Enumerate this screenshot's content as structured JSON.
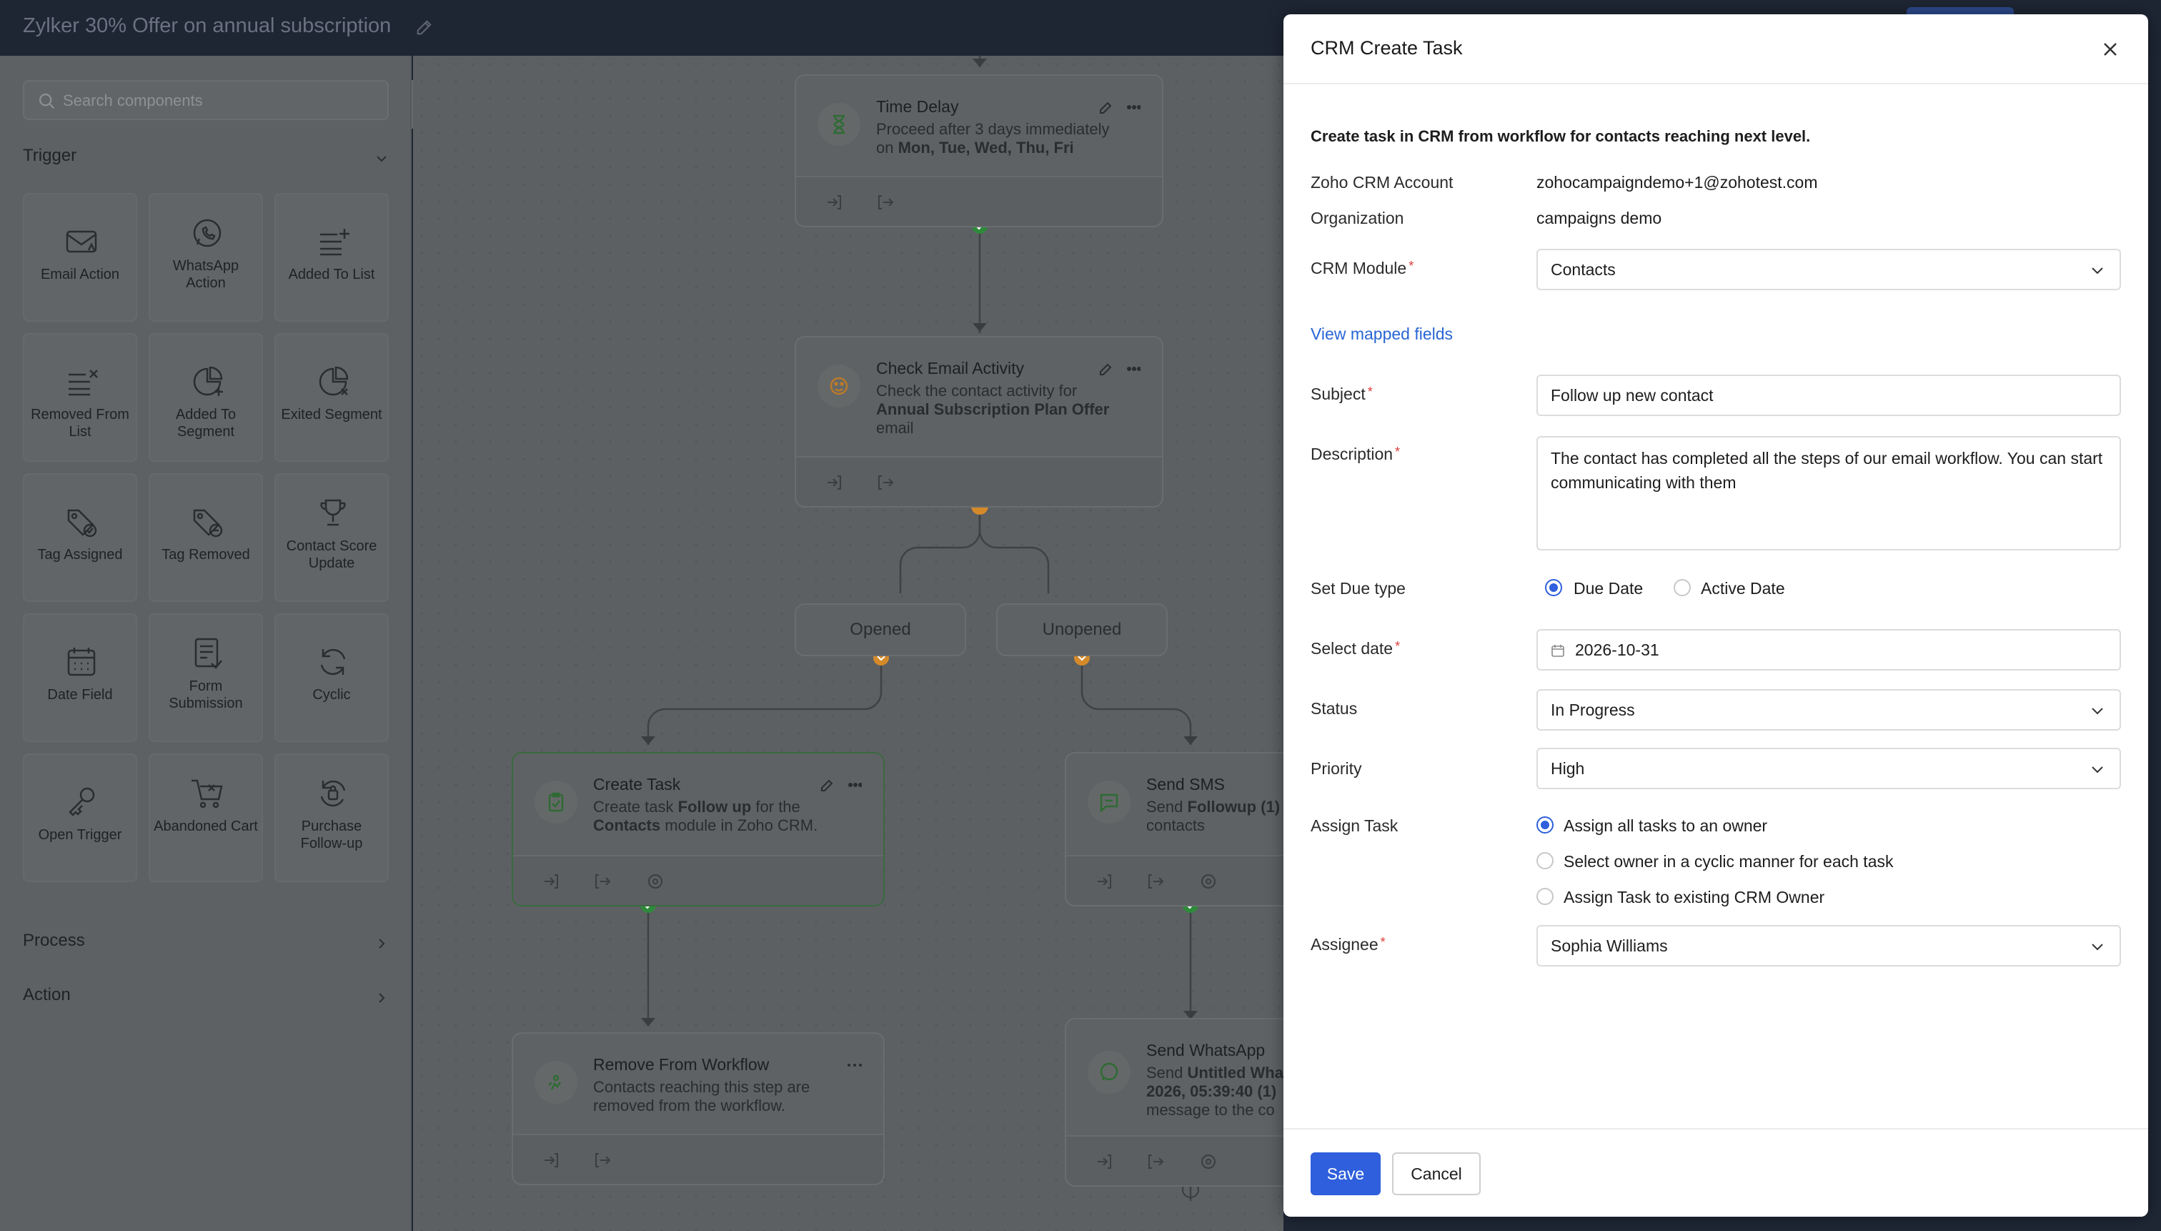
{
  "topbar": {
    "title": "Zylker 30% Offer on annual subscription"
  },
  "sidebar": {
    "search_placeholder": "Search components",
    "trigger_label": "Trigger",
    "process_label": "Process",
    "action_label": "Action",
    "tiles": [
      "Email Action",
      "WhatsApp Action",
      "Added To List",
      "Removed From List",
      "Added To Segment",
      "Exited Segment",
      "Tag Assigned",
      "Tag Removed",
      "Contact Score Update",
      "Date Field",
      "Form Submission",
      "Cyclic",
      "Open Trigger",
      "Abandoned Cart",
      "Purchase Follow-up"
    ]
  },
  "canvas": {
    "time_delay": {
      "title": "Time Delay",
      "desc_1": "Proceed after 3 days immediately",
      "desc_2": "on",
      "desc_bold": "Mon, Tue, Wed, Thu, Fri"
    },
    "check_email": {
      "title": "Check Email Activity",
      "desc_1": "Check the contact activity for",
      "desc_bold": "Annual Subscription Plan Offer",
      "desc_2": "email"
    },
    "branch_opened": "Opened",
    "branch_unopened": "Unopened",
    "create_task": {
      "title": "Create Task",
      "desc_1": "Create task",
      "desc_bold1": "Follow up",
      "desc_2": "for the",
      "desc_bold2": "Contacts",
      "desc_3": "module in Zoho CRM."
    },
    "send_sms": {
      "title": "Send SMS",
      "desc_1": "Send",
      "desc_bold": "Followup (1)",
      "desc_2": "contacts"
    },
    "remove_workflow": {
      "title": "Remove From Workflow",
      "desc_1": "Contacts reaching this step are",
      "desc_2": "removed from the workflow."
    },
    "send_whatsapp": {
      "title": "Send WhatsApp",
      "desc_1": "Send",
      "desc_bold": "Untitled Wha",
      "desc_2": "2026, 05:39:40 (1)",
      "desc_3": "message to the co"
    }
  },
  "modal": {
    "title": "CRM Create Task",
    "intro": "Create task in CRM from workflow for contacts reaching next level.",
    "account_label": "Zoho CRM Account",
    "account_value": "zohocampaigndemo+1@zohotest.com",
    "org_label": "Organization",
    "org_value": "campaigns demo",
    "module_label": "CRM Module",
    "module_value": "Contacts",
    "view_mapped": "View mapped fields",
    "subject_label": "Subject",
    "subject_value": "Follow up new contact",
    "description_label": "Description",
    "description_value": "The contact has completed all the steps of our email workflow. You can start communicating with them",
    "due_type_label": "Set Due type",
    "due_date_option": "Due Date",
    "active_date_option": "Active Date",
    "select_date_label": "Select date",
    "select_date_value": "2026-10-31",
    "status_label": "Status",
    "status_value": "In Progress",
    "priority_label": "Priority",
    "priority_value": "High",
    "assign_task_label": "Assign Task",
    "assign_opt1": "Assign all tasks to an owner",
    "assign_opt2": "Select owner in a cyclic manner for each task",
    "assign_opt3": "Assign Task to existing CRM Owner",
    "assignee_label": "Assignee",
    "assignee_value": "Sophia Williams",
    "save_label": "Save",
    "cancel_label": "Cancel",
    "required_mark": "*"
  },
  "colors": {
    "accent": "#2f5fdc",
    "link": "#2865d4",
    "required": "#e03b3b",
    "success": "#2e8a3a",
    "warning": "#d58a2a"
  }
}
